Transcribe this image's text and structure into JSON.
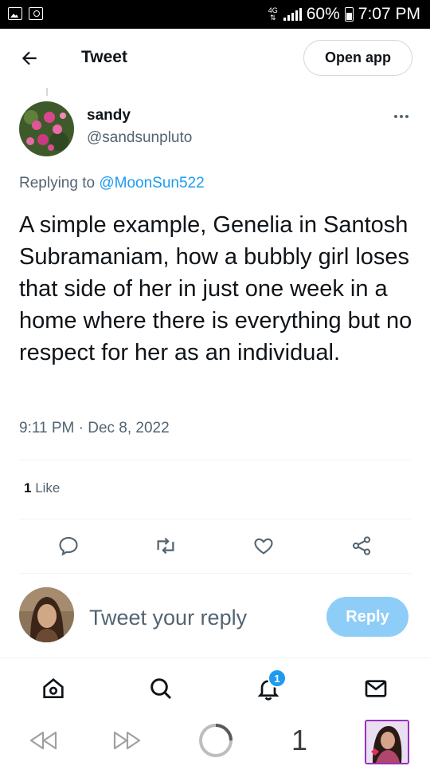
{
  "status_bar": {
    "network": "4G",
    "battery": "60%",
    "time": "7:07 PM"
  },
  "header": {
    "title": "Tweet",
    "open_app_label": "Open app"
  },
  "tweet": {
    "author_name": "sandy",
    "author_handle": "@sandsunpluto",
    "replying_prefix": "Replying to",
    "replying_to": "@MoonSun522",
    "text": "A simple example, Genelia in Santosh Subramaniam, how a bubbly girl loses that side of her in just one week in a home where there is everything but no respect for her as an individual.",
    "timestamp": "9:11 PM · Dec 8, 2022",
    "like_count": "1",
    "like_label": "Like"
  },
  "reply_box": {
    "placeholder": "Tweet your reply",
    "button_label": "Reply"
  },
  "bottom_nav": {
    "notification_badge": "1"
  },
  "browser": {
    "tab_count": "1"
  },
  "colors": {
    "accent": "#1d9bf0",
    "reply_button_disabled": "#8ecdf8",
    "secondary_text": "#536471",
    "thumbnail_border": "#9b2fbf"
  }
}
